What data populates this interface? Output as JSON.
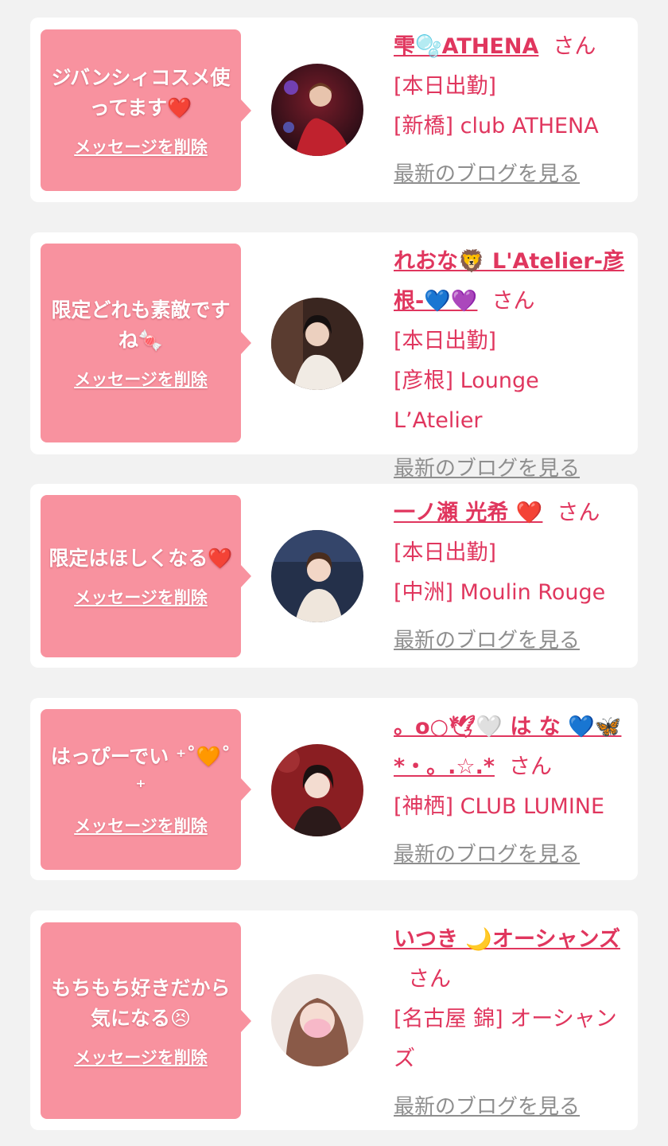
{
  "delete_label": "メッセージを削除",
  "san_label": "さん",
  "blog_label": "最新のブログを見る",
  "cards": [
    {
      "message": "ジバンシィコスメ使ってます❤️",
      "name": "雫🫧ATHENA",
      "lines": [
        "[本日出勤]",
        "[新橋] club ATHENA"
      ]
    },
    {
      "message": "限定どれも素敵ですね🍬",
      "name": "れおな🦁 L'Atelier-彦根-💙💜",
      "lines": [
        "[本日出勤]",
        "[彦根] Lounge L’Atelier"
      ]
    },
    {
      "message": "限定はほしくなる❤️",
      "name": "一ノ瀬 光希 ❤️",
      "lines": [
        "[本日出勤]",
        "[中洲] Moulin Rouge"
      ]
    },
    {
      "message": "はっぴーでい ⁺˚🧡˚⁺",
      "name": "。o○🕊🤍 は な 💙🦋 *・。.☆.*",
      "lines": [
        "[神栖] CLUB LUMINE"
      ]
    },
    {
      "message": "もちもち好きだから気になる😣",
      "name": "いつき 🌙オーシャンズ",
      "lines": [
        "[名古屋 錦] オーシャンズ"
      ]
    }
  ],
  "colors": {
    "page_bg": "#f2f2f2",
    "bubble": "#f8929f",
    "name_pink": "#e0365e",
    "link_gray": "#8e8e8e"
  }
}
